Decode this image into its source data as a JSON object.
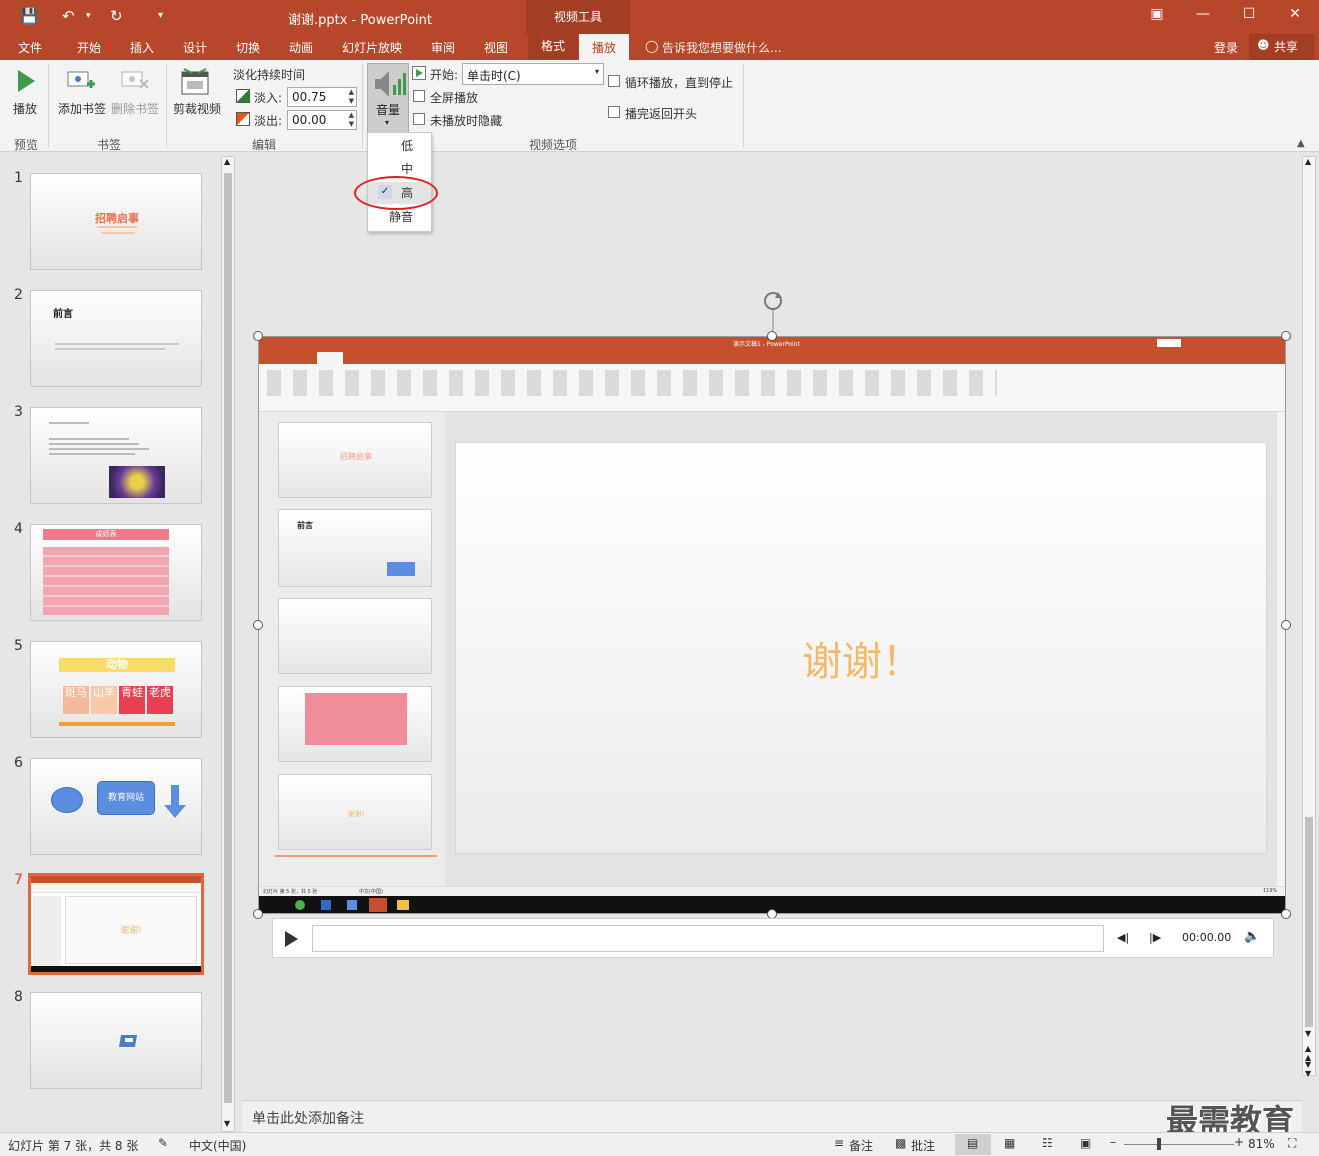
{
  "titlebar": {
    "doc_title": "谢谢.pptx - PowerPoint",
    "context_tools": "视频工具"
  },
  "tabs": {
    "file": "文件",
    "home": "开始",
    "insert": "插入",
    "design": "设计",
    "transitions": "切换",
    "animations": "动画",
    "slideshow": "幻灯片放映",
    "review": "审阅",
    "view": "视图",
    "format": "格式",
    "playback": "播放",
    "tell_me": "告诉我您想要做什么...",
    "signin": "登录",
    "share": "共享"
  },
  "ribbon": {
    "play": "播放",
    "add_bookmark": "添加书签",
    "remove_bookmark": "删除书签",
    "trim_video": "剪裁视频",
    "fade_duration": "淡化持续时间",
    "fade_in_label": "淡入:",
    "fade_in_value": "00.75",
    "fade_out_label": "淡出:",
    "fade_out_value": "00.00",
    "volume": "音量",
    "start_label": "开始:",
    "start_value": "单击时(C)",
    "fullscreen": "全屏播放",
    "hide_not_playing": "未播放时隐藏",
    "loop": "循环播放，直到停止",
    "rewind": "播完返回开头",
    "group_preview": "预览",
    "group_bookmarks": "书签",
    "group_edit": "编辑",
    "group_video_options": "视频选项"
  },
  "volume_menu": {
    "items": [
      "低",
      "中",
      "高",
      "静音"
    ],
    "selected": "高"
  },
  "thumbnails": [
    {
      "num": "1",
      "title": "招聘启事"
    },
    {
      "num": "2",
      "title": "前言"
    },
    {
      "num": "3"
    },
    {
      "num": "4",
      "title": "成绩表"
    },
    {
      "num": "5",
      "title": "动物",
      "cells": [
        "斑马",
        "山羊",
        "青蛙",
        "老虎"
      ]
    },
    {
      "num": "6",
      "button": "教育网站"
    },
    {
      "num": "7",
      "text": "谢谢!"
    },
    {
      "num": "8"
    }
  ],
  "slide": {
    "inner_title": "演示文稿1 - PowerPoint",
    "big_text": "谢谢！",
    "inner_thumb1": "招聘启事",
    "inner_thumb2": "前言",
    "inner_thumb5": "谢谢!",
    "inner_status": "幻灯片 第 5 张，共 5 张",
    "inner_lang": "中文(中国)",
    "inner_zoom": "119%"
  },
  "player": {
    "time": "00:00.00"
  },
  "notes_placeholder": "单击此处添加备注",
  "watermark": "最需教育",
  "status": {
    "slide_info": "幻灯片 第 7 张，共 8 张",
    "language": "中文(中国)",
    "notes": "备注",
    "comments": "批注",
    "zoom": "81%"
  },
  "colors": {
    "accent": "#b7472a",
    "highlight_circle": "#e02020"
  }
}
